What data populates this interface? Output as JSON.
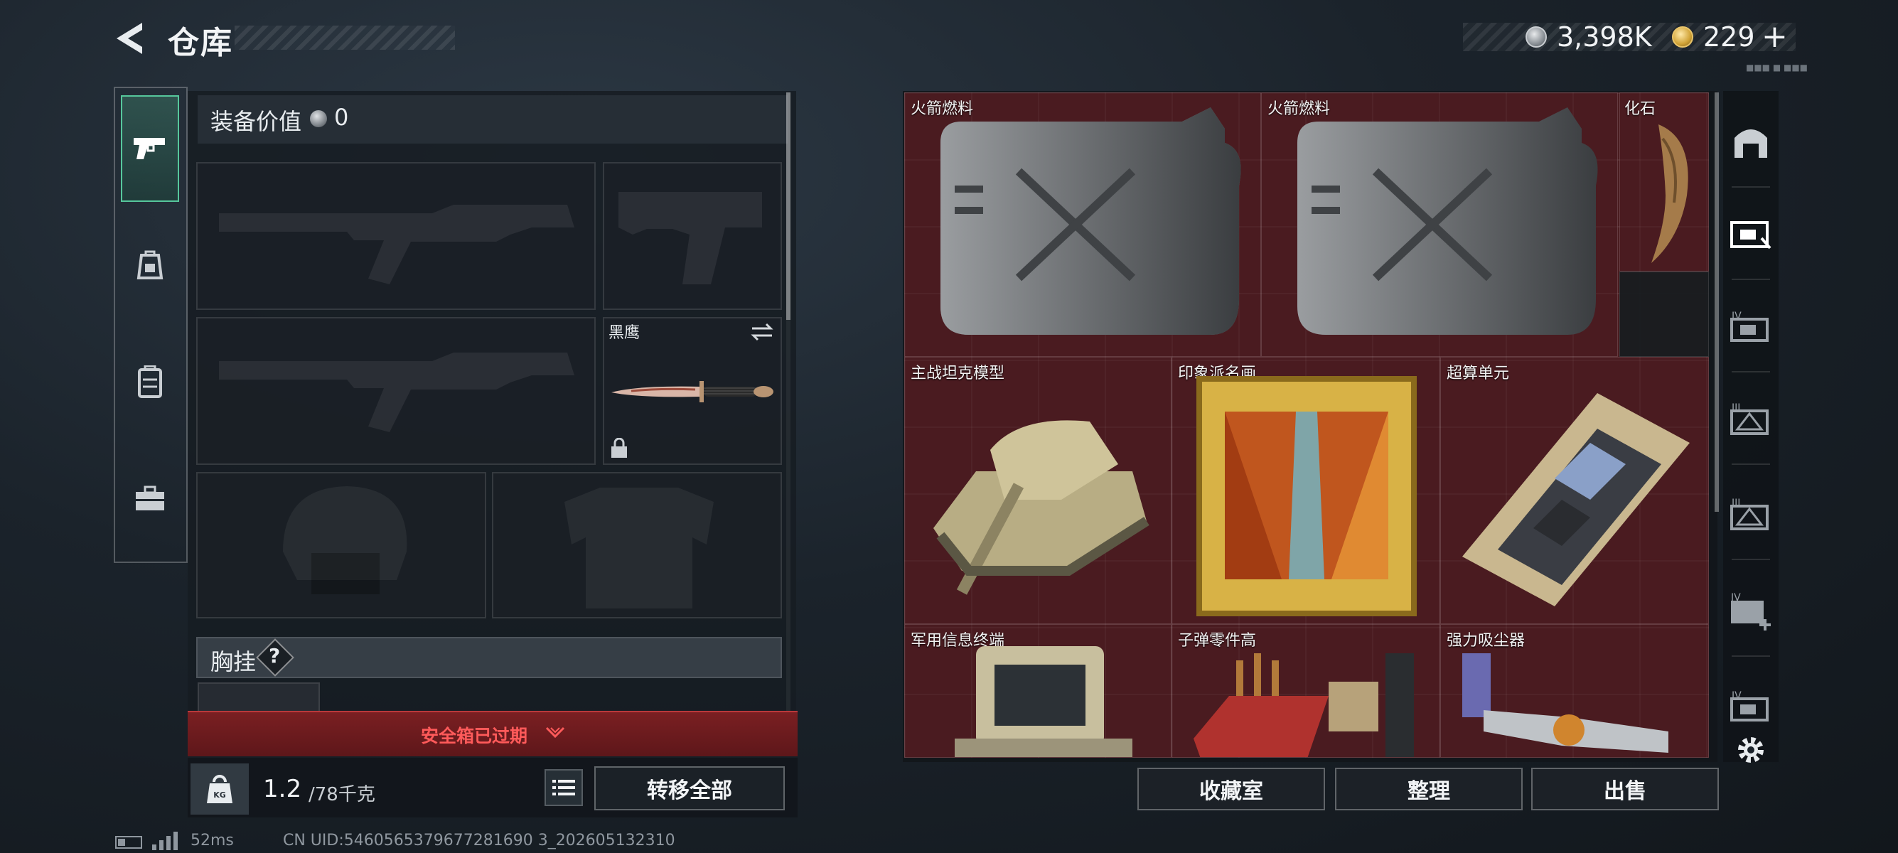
{
  "header": {
    "title": "仓库",
    "currency": {
      "money": "3,398K",
      "gold": "229",
      "gold_plus": "+"
    }
  },
  "categories": [
    {
      "name": "weapons",
      "icon": "pistol-icon",
      "active": true
    },
    {
      "name": "backpack",
      "icon": "backpack-icon",
      "active": false
    },
    {
      "name": "vest",
      "icon": "vest-icon",
      "active": false
    },
    {
      "name": "case",
      "icon": "briefcase-icon",
      "active": false
    }
  ],
  "loadout": {
    "equip_value_label": "装备价值",
    "equip_value": "0",
    "melee_name": "黑鹰",
    "chest_rig_label": "胸挂",
    "help": "?"
  },
  "safebox": {
    "expired_text": "安全箱已过期"
  },
  "weight": {
    "current": "1.2",
    "max": "/78千克",
    "kg": "KG"
  },
  "buttons": {
    "transfer_all": "转移全部",
    "collection": "收藏室",
    "sort": "整理",
    "sell": "出售"
  },
  "stash_items": [
    {
      "name": "火箭燃料"
    },
    {
      "name": "火箭燃料"
    },
    {
      "name": "化石"
    },
    {
      "name": "主战坦克模型"
    },
    {
      "name": "印象派名画"
    },
    {
      "name": "超算单元"
    },
    {
      "name": "军用信息终端"
    },
    {
      "name": "子弹零件高"
    },
    {
      "name": "强力吸尘器"
    }
  ],
  "rail_icons": [
    "home-icon",
    "stash-tab-icon",
    "stash-tab-iv-icon",
    "stash-tab-iii-icon",
    "stash-tab-iii-b-icon",
    "stash-add-iv-icon",
    "stash-tab-iv-b-icon",
    "settings-icon"
  ],
  "status": {
    "ping": "52ms",
    "uid": "CN UID:5460565379677281690 3_202605132310"
  },
  "colors": {
    "accent_green": "#56c79c",
    "danger": "#ff5a5a",
    "stash_bg": "#4a1c20"
  }
}
